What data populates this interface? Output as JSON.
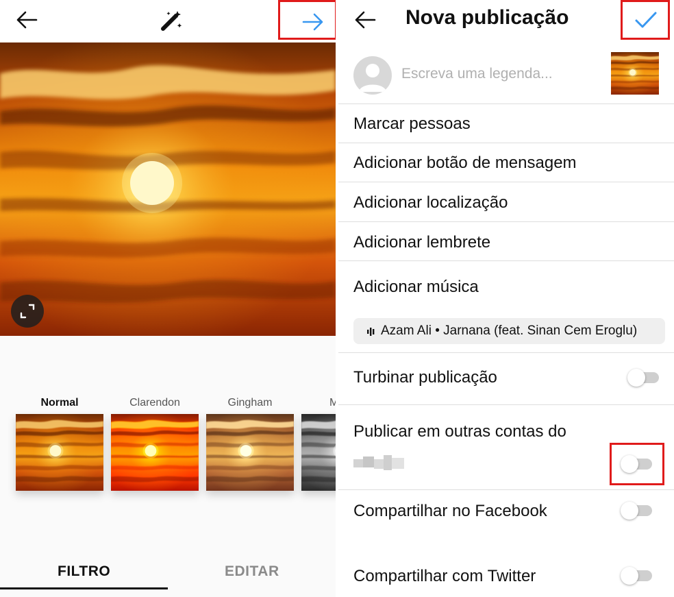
{
  "editor": {
    "filters": [
      {
        "name": "Normal",
        "selected": true
      },
      {
        "name": "Clarendon",
        "selected": false
      },
      {
        "name": "Gingham",
        "selected": false
      },
      {
        "name": "M",
        "selected": false
      }
    ],
    "tabs": {
      "filter": "FILTRO",
      "edit": "EDITAR"
    },
    "icons": {
      "back": "arrow-left-icon",
      "magic": "magic-wand-icon",
      "next": "arrow-right-icon",
      "expand": "expand-icon"
    },
    "colors": {
      "accent": "#3897f0",
      "highlight": "#e01b1b"
    }
  },
  "new_post": {
    "title": "Nova publicação",
    "caption_placeholder": "Escreva uma legenda...",
    "options": {
      "tag_people": "Marcar pessoas",
      "message_button": "Adicionar botão de mensagem",
      "location": "Adicionar localização",
      "reminder": "Adicionar lembrete",
      "music": "Adicionar música"
    },
    "music_chip": "Azam Ali • Jarnana (feat. Sinan Cem Eroglu)",
    "toggles": {
      "boost": {
        "label": "Turbinar publicação",
        "on": false
      },
      "other_accounts": {
        "label": "Publicar em outras contas do",
        "on": false
      },
      "facebook": {
        "label": "Compartilhar no Facebook",
        "on": false
      },
      "twitter": {
        "label": "Compartilhar com Twitter",
        "on": false
      }
    },
    "icons": {
      "back": "arrow-left-icon",
      "confirm": "checkmark-icon",
      "avatar": "avatar-icon",
      "music": "audio-bars-icon"
    }
  }
}
